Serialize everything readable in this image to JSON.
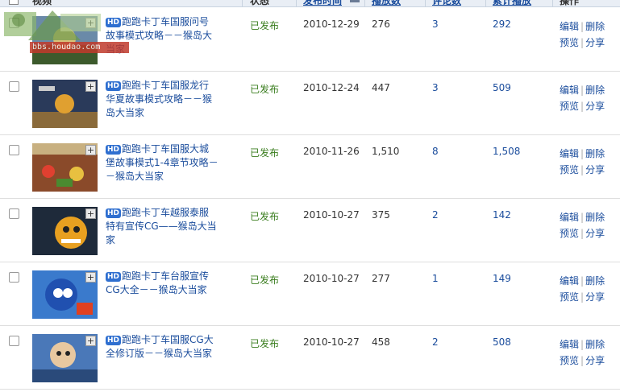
{
  "header": {
    "columns": [
      "视频",
      "状态",
      "发布时间",
      "播放数",
      "评论数",
      "累计播放",
      "操作"
    ]
  },
  "watermark": {
    "text": "bbs.houdao.com"
  },
  "actions": {
    "edit": "编辑",
    "delete": "删除",
    "preview": "预览",
    "share": "分享"
  },
  "hd_badge": "HD",
  "rows": [
    {
      "title": "跑跑卡丁车国服问号故事模式攻略－－猴岛大当家",
      "status": "已发布",
      "date": "2010-12-29",
      "plays": "276",
      "comments": "3",
      "total": "292"
    },
    {
      "title": "跑跑卡丁车国服龙行华夏故事模式攻略－－猴岛大当家",
      "status": "已发布",
      "date": "2010-12-24",
      "plays": "447",
      "comments": "3",
      "total": "509"
    },
    {
      "title": "跑跑卡丁车国服大城堡故事模式1-4章节攻略－－猴岛大当家",
      "status": "已发布",
      "date": "2010-11-26",
      "plays": "1,510",
      "comments": "8",
      "total": "1,508"
    },
    {
      "title": "跑跑卡丁车越服泰服特有宣传CG——猴岛大当家",
      "status": "已发布",
      "date": "2010-10-27",
      "plays": "375",
      "comments": "2",
      "total": "142"
    },
    {
      "title": "跑跑卡丁车台服宣传CG大全－－猴岛大当家",
      "status": "已发布",
      "date": "2010-10-27",
      "plays": "277",
      "comments": "1",
      "total": "149"
    },
    {
      "title": "跑跑卡丁车国服CG大全修订版－－猴岛大当家",
      "status": "已发布",
      "date": "2010-10-27",
      "plays": "458",
      "comments": "2",
      "total": "508"
    }
  ]
}
